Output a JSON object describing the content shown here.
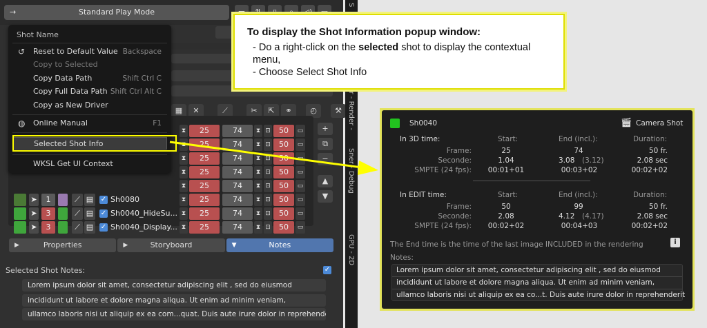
{
  "header": {
    "play_mode_label": "Standard Play Mode",
    "arrow_glyph": "→"
  },
  "side_tabs": [
    "S",
    "ner - Render -",
    "Sner - Debug",
    "GPU - 2D"
  ],
  "context_menu": {
    "title": "Shot Name",
    "items": [
      {
        "label": "Reset to Default Value",
        "shortcut": "Backspace",
        "disabled": false,
        "icon": "reset-icon"
      },
      {
        "label": "Copy to Selected",
        "shortcut": "",
        "disabled": true
      },
      {
        "label": "Copy Data Path",
        "shortcut": "Shift Ctrl C",
        "disabled": false
      },
      {
        "label": "Copy Full Data Path",
        "shortcut": "Shift Ctrl Alt C",
        "disabled": false
      },
      {
        "label": "Copy as New Driver",
        "shortcut": "",
        "disabled": false
      },
      {
        "label": "Online Manual",
        "shortcut": "F1",
        "disabled": false,
        "icon": "globe-icon"
      },
      {
        "label": "Selected Shot Info",
        "shortcut": "",
        "disabled": false,
        "highlight": true
      },
      {
        "label": "WKSL Get UI Context",
        "shortcut": "",
        "disabled": false
      }
    ]
  },
  "shot_rows": [
    {
      "name": "",
      "num": "",
      "start": "25",
      "end": "74",
      "dur": "50"
    },
    {
      "name": "",
      "num": "",
      "start": "25",
      "end": "74",
      "dur": "50"
    },
    {
      "name": "",
      "num": "",
      "start": "25",
      "end": "74",
      "dur": "50"
    },
    {
      "name": "",
      "num": "",
      "start": "25",
      "end": "74",
      "dur": "50"
    },
    {
      "name": "",
      "num": "",
      "start": "25",
      "end": "74",
      "dur": "50"
    },
    {
      "name": "Sh0080",
      "num": "1",
      "start": "25",
      "end": "74",
      "dur": "50"
    },
    {
      "name": "Sh0040_HideSu...",
      "num": "3",
      "start": "25",
      "end": "74",
      "dur": "50"
    },
    {
      "name": "Sh0040_Display...",
      "num": "3",
      "start": "25",
      "end": "74",
      "dur": "50"
    }
  ],
  "tabs": [
    {
      "label": "Properties",
      "active": false
    },
    {
      "label": "Storyboard",
      "active": false
    },
    {
      "label": "Notes",
      "active": true
    }
  ],
  "selected_notes": {
    "label": "Selected Shot Notes:",
    "lines": [
      "Lorem ipsum dolor sit amet, consectetur adipiscing elit , sed do eiusmod",
      "incididunt ut labore et dolore magna aliqua. Ut enim ad minim veniam,",
      "ullamco laboris nisi ut aliquip ex ea com...quat. Duis aute irure dolor in reprehenderit"
    ]
  },
  "annotation": {
    "title": "To display the Shot Information popup window:",
    "line1_prefix": "- Do a right-click on the ",
    "line1_bold": "selected",
    "line1_suffix": " shot to display the contextual menu,",
    "line2": "- Choose Select Shot Info"
  },
  "popup": {
    "shot_name": "Sh0040",
    "shot_color": "#22c21f",
    "camera_label": "Camera Shot",
    "col_start": "Start:",
    "col_end": "End (incl.):",
    "col_duration": "Duration:",
    "time_3d": {
      "title": "In 3D time:",
      "frame": {
        "label": "Frame:",
        "start": "25",
        "end": "74",
        "dur": "50 fr."
      },
      "seconds": {
        "label": "Seconde:",
        "start": "1.04",
        "end": "3.08",
        "end_paren": "(3.12)",
        "dur": "2.08 sec"
      },
      "smpte": {
        "label": "SMPTE (24 fps):",
        "start": "00:01+01",
        "end": "00:03+02",
        "dur": "00:02+02"
      }
    },
    "time_edit": {
      "title": "In EDIT time:",
      "frame": {
        "label": "Frame:",
        "start": "50",
        "end": "99",
        "dur": "50 fr."
      },
      "seconds": {
        "label": "Seconde:",
        "start": "2.08",
        "end": "4.12",
        "end_paren": "(4.17)",
        "dur": "2.08 sec"
      },
      "smpte": {
        "label": "SMPTE (24 fps):",
        "start": "00:02+02",
        "end": "00:04+03",
        "dur": "00:02+02"
      }
    },
    "end_note": "The End time is the time of the last image INCLUDED in the rendering",
    "info_glyph": "i",
    "notes_label": "Notes:",
    "notes_lines": [
      "Lorem ipsum dolor sit amet, consectetur adipiscing elit , sed do eiusmod",
      "incididunt ut labore et dolore magna aliqua. Ut enim ad minim veniam,",
      "ullamco laboris nisi ut aliquip ex ea co...t. Duis aute irure dolor in reprehenderit"
    ]
  },
  "colors": {
    "accent_yellow": "#ffff00",
    "red_cell": "#b85050",
    "green_cell": "#3fa63c"
  }
}
